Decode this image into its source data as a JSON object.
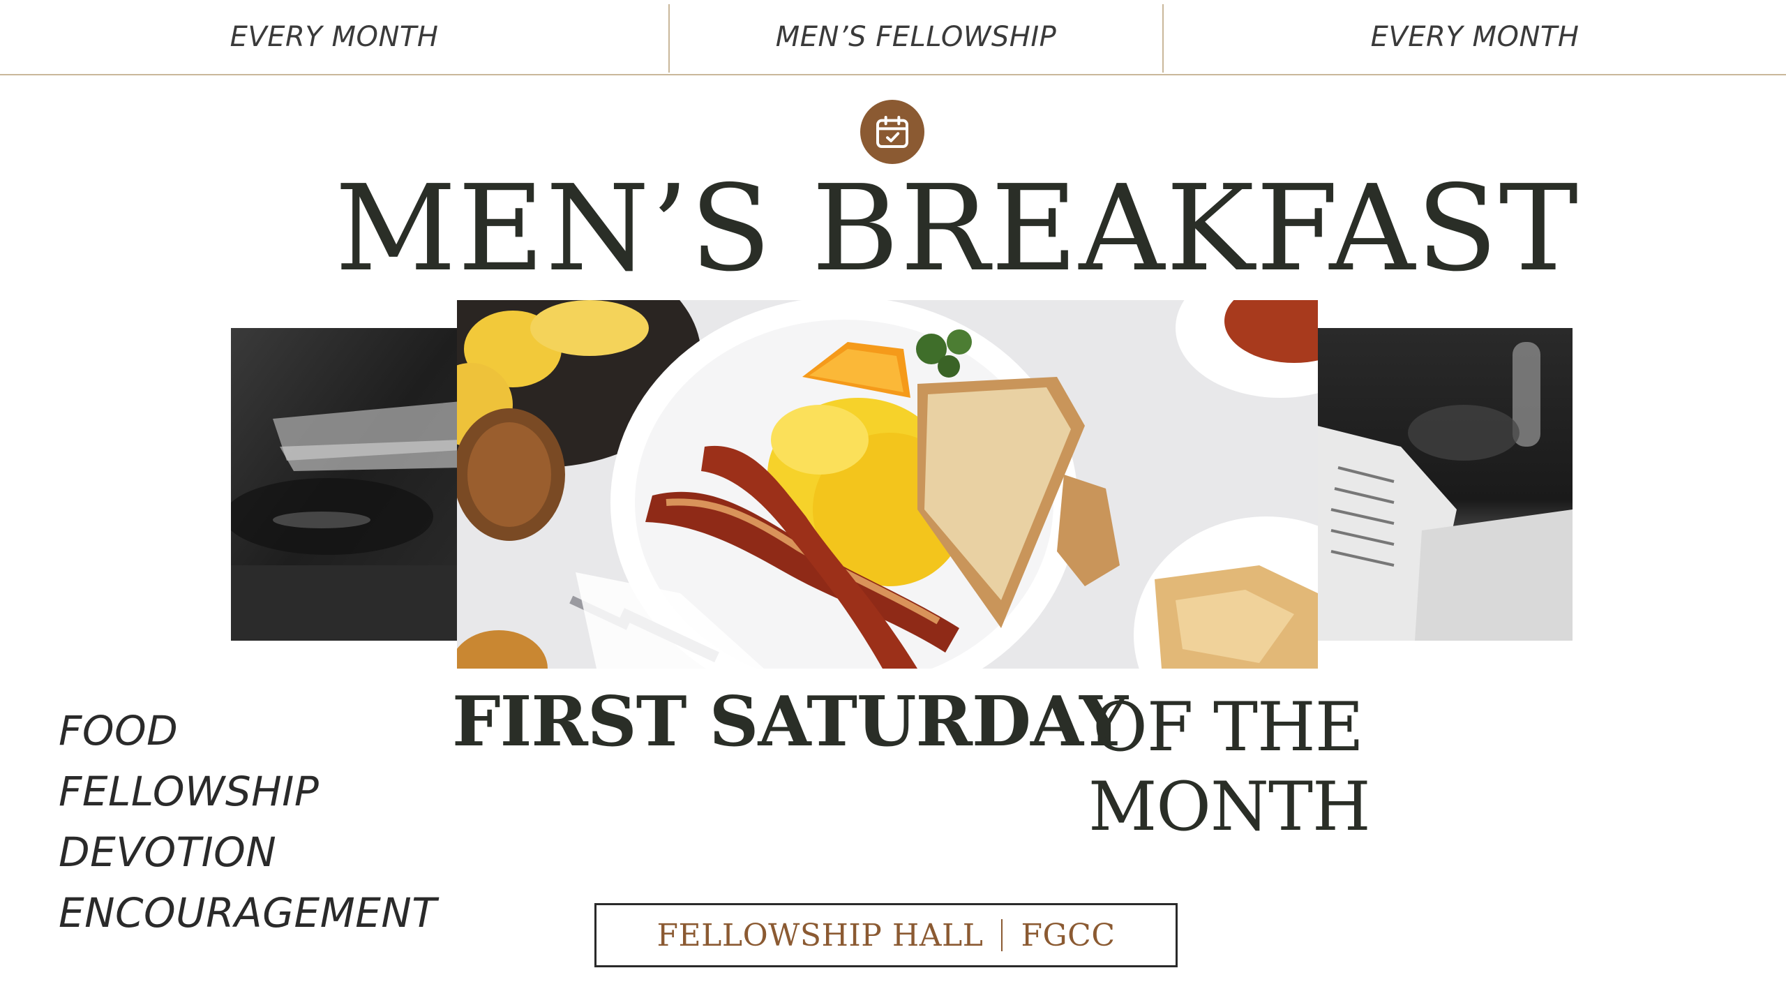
{
  "top_banner": {
    "left": "EVERY MONTH",
    "center": "MEN’S FELLOWSHIP",
    "right": "EVERY MONTH"
  },
  "icons": {
    "calendar": "calendar-check-icon"
  },
  "title": "MEN’S BREAKFAST",
  "schedule": {
    "day": "FIRST SATURDAY",
    "of_line1": "OF THE",
    "of_line2": "MONTH"
  },
  "highlights": [
    "FOOD",
    "FELLOWSHIP",
    "DEVOTION",
    "ENCOURAGEMENT"
  ],
  "location": {
    "place": "FELLOWSHIP HALL",
    "org": "FGCC"
  },
  "colors": {
    "accent_brown": "#8b5a32",
    "title_dark": "#2a2e27",
    "divider_tan": "#c9b79a"
  }
}
